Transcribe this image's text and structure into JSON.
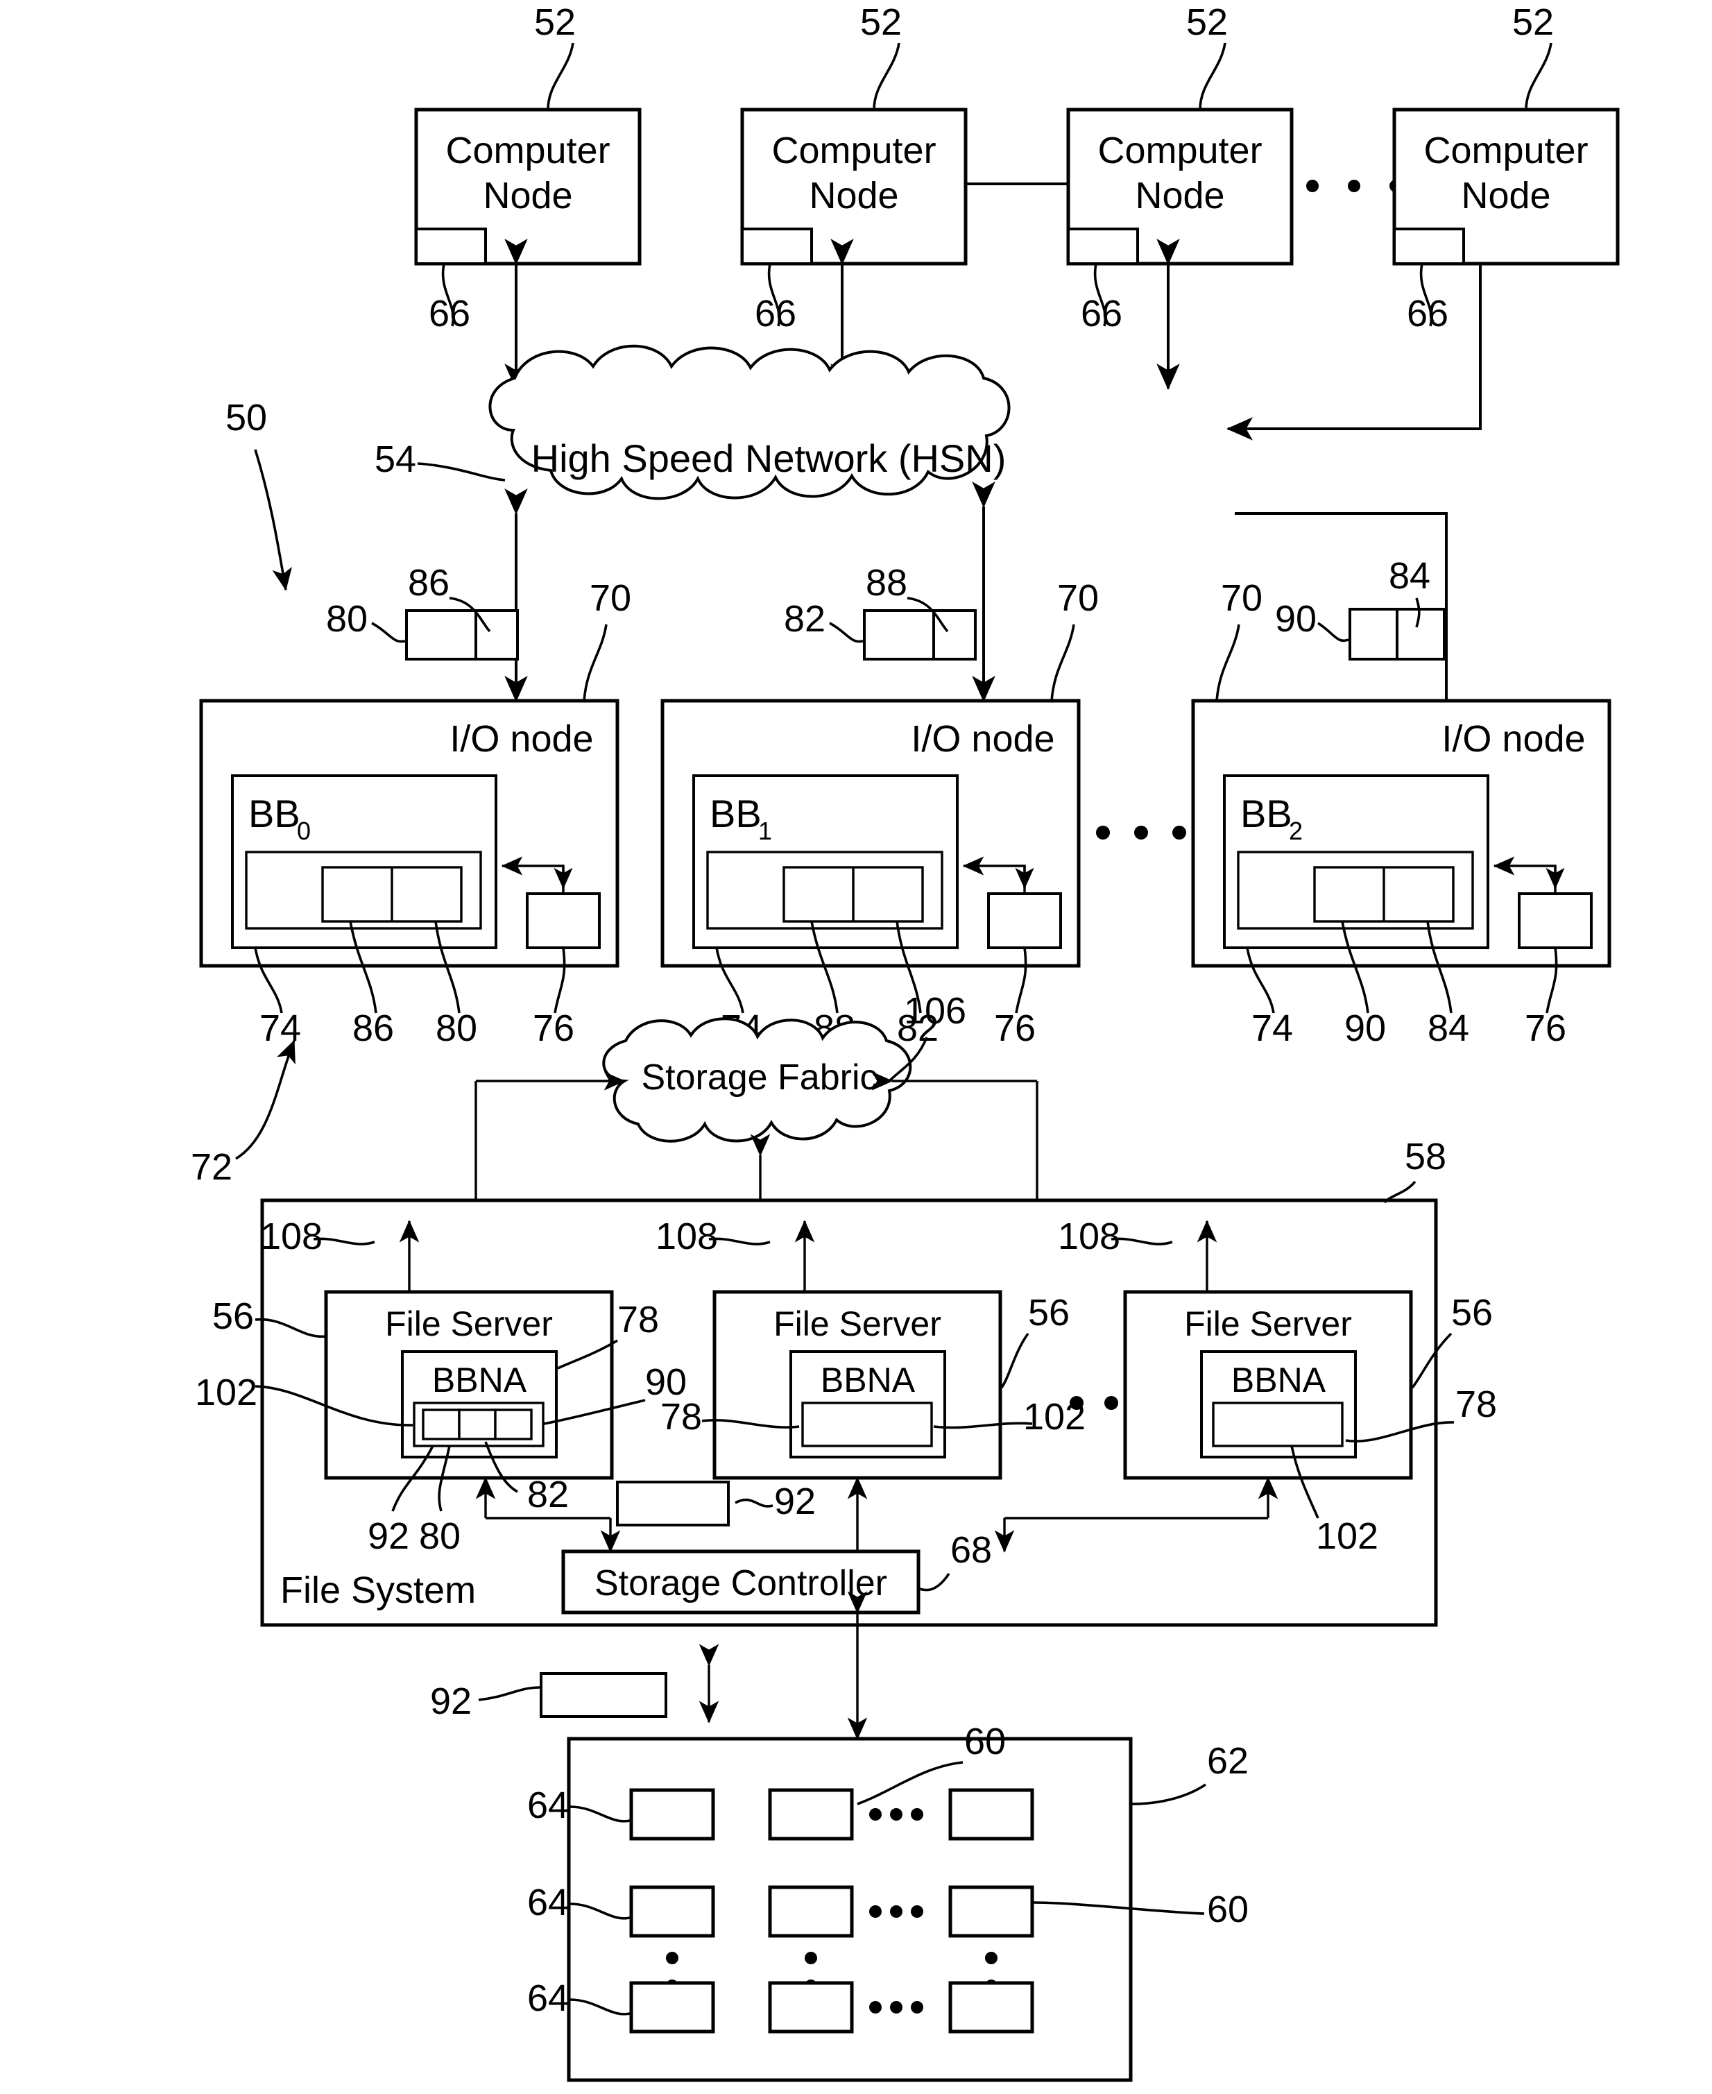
{
  "figure": {
    "system_ref": "50",
    "nodes": {
      "computer_node_label": "Computer Node",
      "computer_node_line1": "Computer",
      "computer_node_line2": "Node",
      "computer_node_ref": "52",
      "nic_ref": "66",
      "count_visible": 4
    },
    "hsn": {
      "label": "High Speed Network (HSN)",
      "ref": "54"
    },
    "io_nodes": {
      "label": "I/O node",
      "ref": "70",
      "burst_buffers": [
        "BB",
        "BB",
        "BB"
      ],
      "burst_buffer_subs": [
        "0",
        "1",
        "2"
      ],
      "bb_ref": "74",
      "agent_ref": "76",
      "items": [
        {
          "bb_name": "BB",
          "bb_sub": "0",
          "seg_a_ref": "86",
          "seg_b_ref": "80",
          "ext_left_ref": "80",
          "ext_right_ref": "86",
          "below_refs": [
            "74",
            "86",
            "80",
            "76"
          ]
        },
        {
          "bb_name": "BB",
          "bb_sub": "1",
          "seg_a_ref": "88",
          "seg_b_ref": "82",
          "ext_left_ref": "82",
          "ext_right_ref": "88",
          "below_refs": [
            "74",
            "88",
            "82",
            "76"
          ]
        },
        {
          "bb_name": "BB",
          "bb_sub": "2",
          "seg_a_ref": "90",
          "seg_b_ref": "84",
          "ext_left_ref": "90",
          "ext_right_ref": "84",
          "below_refs": [
            "74",
            "90",
            "84",
            "76"
          ]
        }
      ]
    },
    "storage_fabric": {
      "label": "Storage Fabric",
      "ref": "106",
      "io_arrow_ref": "72"
    },
    "file_system": {
      "label": "File System",
      "ref": "58",
      "file_server_label": "File Server",
      "file_server_ref": "56",
      "bbna_label": "BBNA",
      "bbna_ref": "78",
      "buffer_ref": "102",
      "link_ref": "108",
      "servers": [
        {
          "label": "File Server",
          "bbna": "BBNA",
          "refs_right": [
            "78",
            "90"
          ],
          "refs_left": [
            "56",
            "102"
          ],
          "refs_below": [
            "92",
            "80",
            "82"
          ]
        },
        {
          "label": "File Server",
          "bbna": "BBNA",
          "refs_right": [
            "56",
            "102"
          ],
          "refs_left": [
            "78"
          ],
          "refs_below": []
        },
        {
          "label": "File Server",
          "bbna": "BBNA",
          "refs_right": [
            "56",
            "78"
          ],
          "refs_left": [],
          "refs_below": [
            "102"
          ]
        }
      ],
      "storage_controller": {
        "label": "Storage Controller",
        "ref": "68"
      },
      "message_ref": "92"
    },
    "storage_array": {
      "ref": "62",
      "device_ref": "60",
      "row_ref": "64",
      "rows": 3,
      "cols": 3,
      "message_ref": "92"
    },
    "ellipsis": "•  •  •"
  }
}
